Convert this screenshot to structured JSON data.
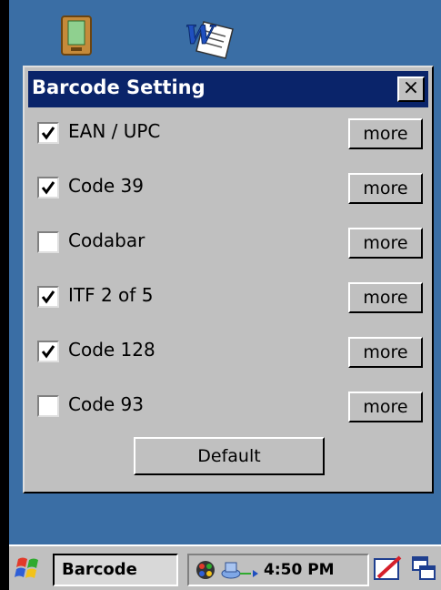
{
  "dialog": {
    "title": "Barcode Setting",
    "close_label": "×",
    "items": [
      {
        "label": "EAN / UPC",
        "checked": true,
        "more": "more"
      },
      {
        "label": "Code 39",
        "checked": true,
        "more": "more"
      },
      {
        "label": "Codabar",
        "checked": false,
        "more": "more"
      },
      {
        "label": "ITF 2 of 5",
        "checked": true,
        "more": "more"
      },
      {
        "label": "Code 128",
        "checked": true,
        "more": "more"
      },
      {
        "label": "Code 93",
        "checked": false,
        "more": "more"
      }
    ],
    "default_label": "Default"
  },
  "taskbar": {
    "task_label": "Barcode",
    "clock": "4:50 PM"
  },
  "icons": [
    "pda-icon",
    "word-document-icon",
    "start-flag-icon",
    "network-icon",
    "connection-icon",
    "pen-icon",
    "window-switch-icon"
  ],
  "colors": {
    "desktop": "#3a6ea5",
    "titlebar": "#0a246a",
    "face": "#c0c0c0"
  }
}
